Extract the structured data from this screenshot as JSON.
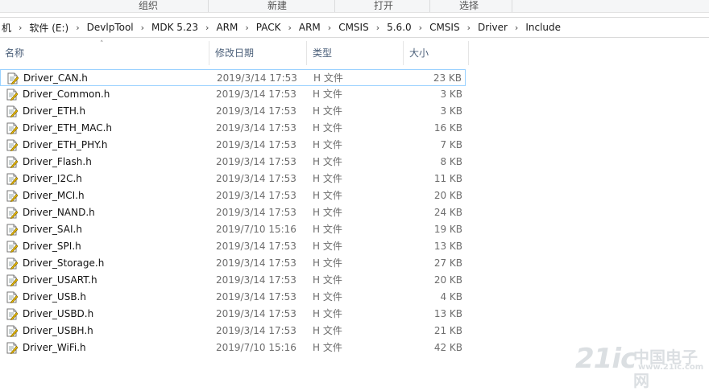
{
  "ribbon": {
    "labels": [
      "组织",
      "新建",
      "打开",
      "选择"
    ]
  },
  "address": {
    "crumbs": [
      "机",
      "软件 (E:)",
      "DevlpTool",
      "MDK 5.23",
      "ARM",
      "PACK",
      "ARM",
      "CMSIS",
      "5.6.0",
      "CMSIS",
      "Driver",
      "Include"
    ]
  },
  "columns": {
    "name": "名称",
    "date": "修改日期",
    "type": "类型",
    "size": "大小"
  },
  "files": [
    {
      "name": "Driver_CAN.h",
      "date": "2019/3/14 17:53",
      "type": "H 文件",
      "size": "23 KB"
    },
    {
      "name": "Driver_Common.h",
      "date": "2019/3/14 17:53",
      "type": "H 文件",
      "size": "3 KB"
    },
    {
      "name": "Driver_ETH.h",
      "date": "2019/3/14 17:53",
      "type": "H 文件",
      "size": "3 KB"
    },
    {
      "name": "Driver_ETH_MAC.h",
      "date": "2019/3/14 17:53",
      "type": "H 文件",
      "size": "16 KB"
    },
    {
      "name": "Driver_ETH_PHY.h",
      "date": "2019/3/14 17:53",
      "type": "H 文件",
      "size": "7 KB"
    },
    {
      "name": "Driver_Flash.h",
      "date": "2019/3/14 17:53",
      "type": "H 文件",
      "size": "8 KB"
    },
    {
      "name": "Driver_I2C.h",
      "date": "2019/3/14 17:53",
      "type": "H 文件",
      "size": "11 KB"
    },
    {
      "name": "Driver_MCI.h",
      "date": "2019/3/14 17:53",
      "type": "H 文件",
      "size": "20 KB"
    },
    {
      "name": "Driver_NAND.h",
      "date": "2019/3/14 17:53",
      "type": "H 文件",
      "size": "24 KB"
    },
    {
      "name": "Driver_SAI.h",
      "date": "2019/7/10 15:16",
      "type": "H 文件",
      "size": "19 KB"
    },
    {
      "name": "Driver_SPI.h",
      "date": "2019/3/14 17:53",
      "type": "H 文件",
      "size": "13 KB"
    },
    {
      "name": "Driver_Storage.h",
      "date": "2019/3/14 17:53",
      "type": "H 文件",
      "size": "27 KB"
    },
    {
      "name": "Driver_USART.h",
      "date": "2019/3/14 17:53",
      "type": "H 文件",
      "size": "20 KB"
    },
    {
      "name": "Driver_USB.h",
      "date": "2019/3/14 17:53",
      "type": "H 文件",
      "size": "4 KB"
    },
    {
      "name": "Driver_USBD.h",
      "date": "2019/3/14 17:53",
      "type": "H 文件",
      "size": "13 KB"
    },
    {
      "name": "Driver_USBH.h",
      "date": "2019/3/14 17:53",
      "type": "H 文件",
      "size": "21 KB"
    },
    {
      "name": "Driver_WiFi.h",
      "date": "2019/7/10 15:16",
      "type": "H 文件",
      "size": "42 KB"
    }
  ],
  "watermark": {
    "logo": "21ic",
    "name": "中国电子网",
    "url": "www.21ic.com"
  },
  "colors": {
    "selection_border": "#99d1ff",
    "header_text": "#4c607a",
    "icon_accent": "#f5c400"
  },
  "icons": {
    "file": "h-file-icon",
    "chevron": "chevron-right-icon",
    "sort": "sort-up-icon"
  }
}
